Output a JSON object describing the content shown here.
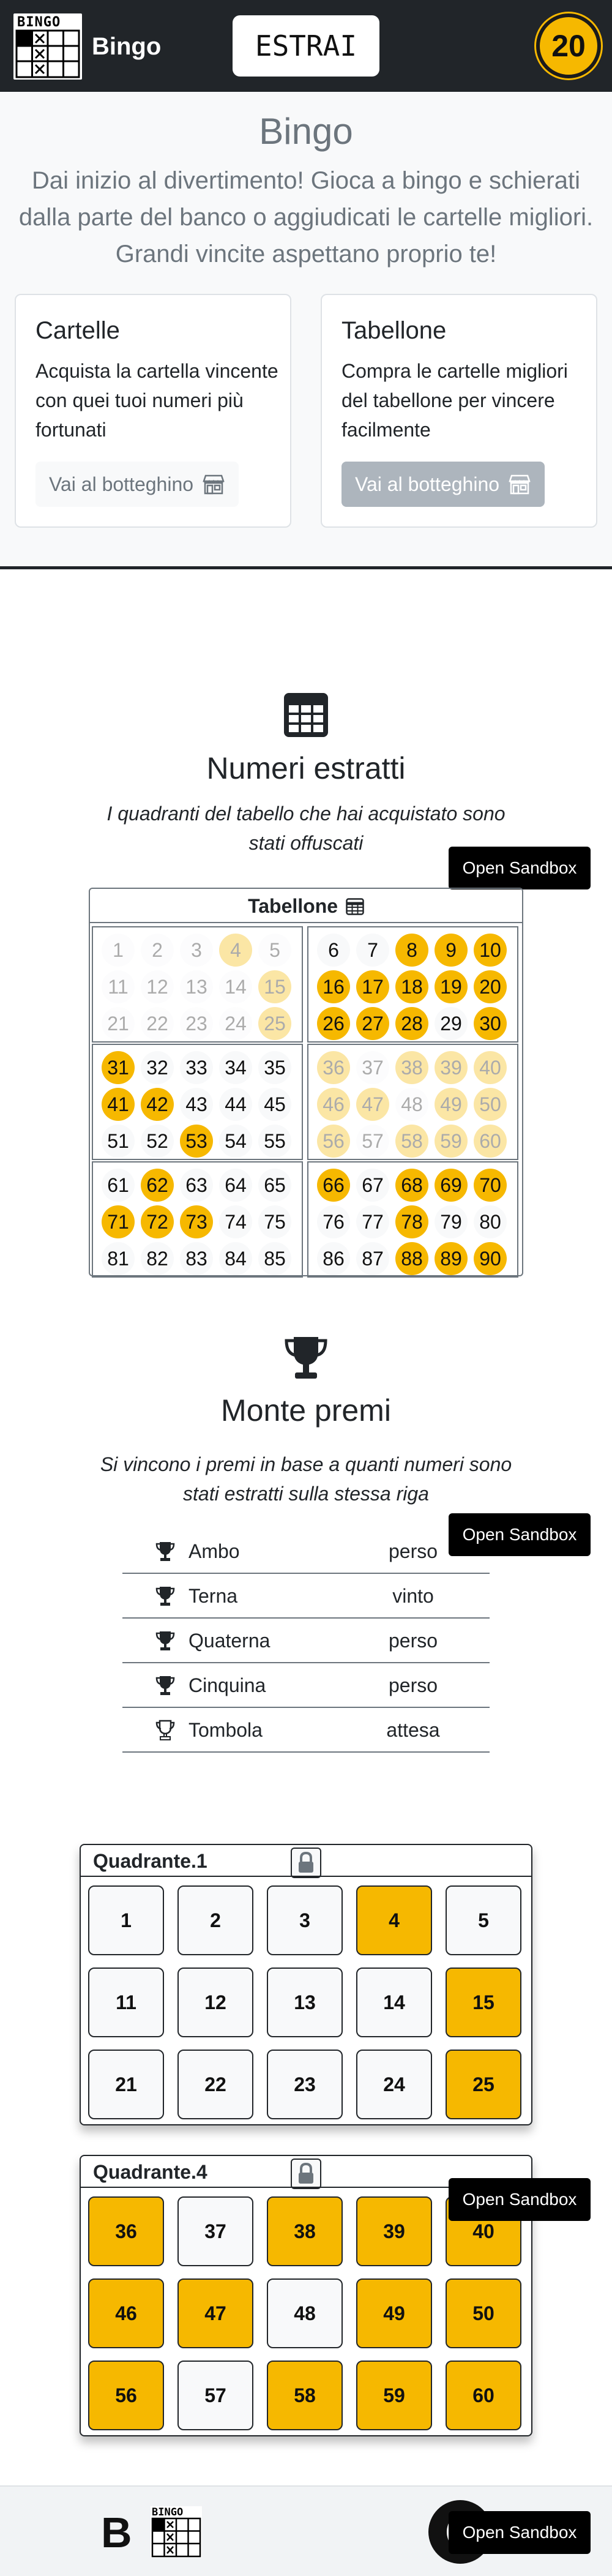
{
  "header": {
    "logo_text": "BINGO",
    "brand_name": "Bingo",
    "draw_button": "ESTRAI",
    "draw_count": "20"
  },
  "hero": {
    "title": "Bingo",
    "lead": "Dai inizio al divertimento! Gioca a bingo e schierati dalla parte del banco o aggiudicati le cartelle migliori. Grandi vincite aspettano proprio te!",
    "cards": [
      {
        "title": "Cartelle",
        "text": "Acquista la cartella vincente con quei tuoi numeri più fortunati",
        "button": "Vai al botteghino",
        "icon": "shop-icon"
      },
      {
        "title": "Tabellone",
        "text": "Compra le cartelle migliori del tabellone per vincere facilmente",
        "button": "Vai al botteghino",
        "icon": "shop-icon"
      }
    ]
  },
  "numbers_section": {
    "icon": "table-icon",
    "title": "Numeri estratti",
    "subtitle": "I quadranti del tabello che hai acquistato sono stati offuscati",
    "sandbox": "Open Sandbox",
    "board_title": "Tabellone",
    "board_icon": "table-icon",
    "quadrants": [
      {
        "name": "1",
        "dim": true,
        "numbers": [
          1,
          2,
          3,
          4,
          5,
          11,
          12,
          13,
          14,
          15,
          21,
          22,
          23,
          24,
          25
        ],
        "drawn": [
          4,
          15,
          25
        ]
      },
      {
        "name": "2",
        "dim": false,
        "numbers": [
          6,
          7,
          8,
          9,
          10,
          16,
          17,
          18,
          19,
          20,
          26,
          27,
          28,
          29,
          30
        ],
        "drawn": [
          8,
          9,
          10,
          16,
          17,
          18,
          19,
          20,
          26,
          27,
          28,
          30
        ]
      },
      {
        "name": "3",
        "dim": false,
        "numbers": [
          31,
          32,
          33,
          34,
          35,
          41,
          42,
          43,
          44,
          45,
          51,
          52,
          53,
          54,
          55
        ],
        "drawn": [
          31,
          41,
          42,
          53
        ]
      },
      {
        "name": "4",
        "dim": true,
        "numbers": [
          36,
          37,
          38,
          39,
          40,
          46,
          47,
          48,
          49,
          50,
          56,
          57,
          58,
          59,
          60
        ],
        "drawn": [
          36,
          38,
          39,
          40,
          46,
          47,
          49,
          50,
          56,
          58,
          59,
          60
        ]
      },
      {
        "name": "5",
        "dim": false,
        "numbers": [
          61,
          62,
          63,
          64,
          65,
          71,
          72,
          73,
          74,
          75,
          81,
          82,
          83,
          84,
          85
        ],
        "drawn": [
          62,
          71,
          72,
          73
        ]
      },
      {
        "name": "6",
        "dim": false,
        "numbers": [
          66,
          67,
          68,
          69,
          70,
          76,
          77,
          78,
          79,
          80,
          86,
          87,
          88,
          89,
          90
        ],
        "drawn": [
          66,
          68,
          69,
          70,
          78,
          88,
          89,
          90
        ]
      }
    ]
  },
  "prizes_section": {
    "icon": "trophy-icon",
    "title": "Monte premi",
    "subtitle": "Si vincono i premi in base a quanti numeri sono stati estratti sulla stessa riga",
    "sandbox": "Open Sandbox",
    "prizes": [
      {
        "name": "Ambo",
        "status": "perso",
        "icon": "trophy-icon"
      },
      {
        "name": "Terna",
        "status": "vinto",
        "icon": "trophy-icon"
      },
      {
        "name": "Quaterna",
        "status": "perso",
        "icon": "trophy-icon"
      },
      {
        "name": "Cinquina",
        "status": "perso",
        "icon": "trophy-icon"
      },
      {
        "name": "Tombola",
        "status": "attesa",
        "icon": "trophy-outline-icon"
      }
    ]
  },
  "quadrant_cards": [
    {
      "title": "Quadrante.1",
      "icon": "lock-icon",
      "numbers": [
        1,
        2,
        3,
        4,
        5,
        11,
        12,
        13,
        14,
        15,
        21,
        22,
        23,
        24,
        25
      ],
      "drawn": [
        4,
        15,
        25
      ]
    },
    {
      "title": "Quadrante.4",
      "icon": "lock-icon",
      "numbers": [
        36,
        37,
        38,
        39,
        40,
        46,
        47,
        48,
        49,
        50,
        56,
        57,
        58,
        59,
        60
      ],
      "drawn": [
        36,
        38,
        39,
        40,
        46,
        47,
        49,
        50,
        56,
        58,
        59,
        60
      ],
      "sandbox": "Open Sandbox"
    }
  ],
  "footer": {
    "logo_letter": "B",
    "logo_text": "BINGO",
    "sandbox": "Open Sandbox"
  },
  "colors": {
    "drawn": "#f6b800",
    "dark": "#212529",
    "muted": "#6c757d"
  }
}
